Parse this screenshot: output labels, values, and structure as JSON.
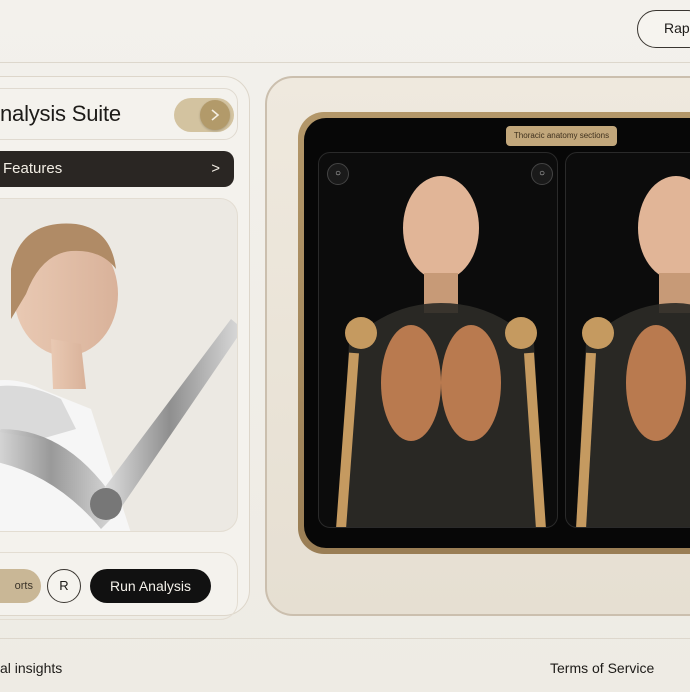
{
  "header": {
    "action_label": "Rapid"
  },
  "left_panel": {
    "title": "nalysis Suite",
    "features_label": "Features",
    "features_chevron": ">",
    "buttons": {
      "reports": "orts",
      "r": "R",
      "run": "Run Analysis"
    }
  },
  "viewer": {
    "label": "Thoracic anatomy sections",
    "controls": {
      "left": "○",
      "right": "○"
    }
  },
  "footer": {
    "left": "al insights",
    "right": "Terms of Service"
  },
  "icons": {
    "toggle": "chevron-right-icon",
    "features": "chevron-right-icon"
  },
  "colors": {
    "accent": "#c9b796",
    "dark": "#111111",
    "frame": "#b39769"
  }
}
